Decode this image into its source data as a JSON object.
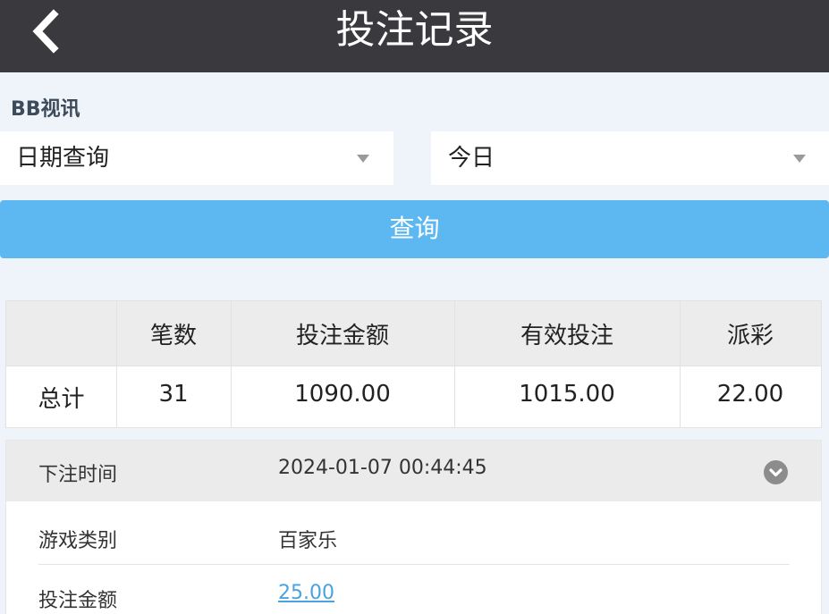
{
  "header": {
    "title": "投注记录"
  },
  "platform": {
    "name": "BB视讯"
  },
  "filters": {
    "field_select": "日期查询",
    "range_select": "今日",
    "query_button": "查询"
  },
  "summary": {
    "columns": [
      "",
      "笔数",
      "投注金额",
      "有效投注",
      "派彩"
    ],
    "row": [
      "总计",
      "31",
      "1090.00",
      "1015.00",
      "22.00"
    ]
  },
  "record": {
    "time_label": "下注时间",
    "time_value": "2024-01-07 00:44:45",
    "game_type_label": "游戏类别",
    "game_type_value": "百家乐",
    "bet_amount_label": "投注金额",
    "bet_amount_value": "25.00"
  },
  "colors": {
    "topbar": "#3a3a3e",
    "accent": "#5db8f2",
    "link": "#4aa3e0"
  },
  "icons": {
    "back": "chevron-left-icon",
    "expand": "chevron-down-circle-icon",
    "caret": "caret-down-icon"
  }
}
